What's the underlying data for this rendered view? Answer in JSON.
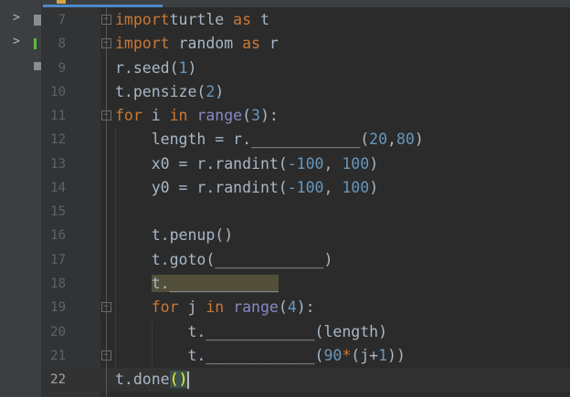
{
  "editor": {
    "current_line": 22,
    "lines": [
      {
        "n": "7",
        "tokens": [
          [
            "kw",
            "import"
          ],
          [
            "",
            "turtle"
          ],
          [
            "kw",
            " as"
          ],
          [
            "",
            " t"
          ]
        ]
      },
      {
        "n": "8",
        "tokens": [
          [
            "kw",
            "import"
          ],
          [
            "",
            " random"
          ],
          [
            "kw",
            " as"
          ],
          [
            "",
            " r"
          ]
        ]
      },
      {
        "n": "9",
        "tokens": [
          [
            "",
            "r.seed("
          ],
          [
            "num",
            "1"
          ],
          [
            "",
            ")"
          ]
        ]
      },
      {
        "n": "10",
        "tokens": [
          [
            "",
            "t.pensize("
          ],
          [
            "num",
            "2"
          ],
          [
            "",
            ")"
          ]
        ]
      },
      {
        "n": "11",
        "tokens": [
          [
            "kw",
            "for"
          ],
          [
            "",
            " i "
          ],
          [
            "kw",
            "in"
          ],
          [
            "",
            " "
          ],
          [
            "bi",
            "range"
          ],
          [
            "",
            "("
          ],
          [
            "num",
            "3"
          ],
          [
            "",
            "):"
          ]
        ]
      },
      {
        "n": "12",
        "tokens": [
          [
            "",
            "    length = r.____________("
          ],
          [
            "num",
            "20"
          ],
          [
            "",
            ","
          ],
          [
            "num",
            "80"
          ],
          [
            "",
            ")"
          ]
        ]
      },
      {
        "n": "13",
        "tokens": [
          [
            "",
            "    x0 = r.randint("
          ],
          [
            "num",
            "-100"
          ],
          [
            "",
            ", "
          ],
          [
            "num",
            "100"
          ],
          [
            "",
            ")"
          ]
        ]
      },
      {
        "n": "14",
        "tokens": [
          [
            "",
            "    y0 = r.randint("
          ],
          [
            "num",
            "-100"
          ],
          [
            "",
            ", "
          ],
          [
            "num",
            "100"
          ],
          [
            "",
            ")"
          ]
        ]
      },
      {
        "n": "15",
        "tokens": []
      },
      {
        "n": "16",
        "tokens": [
          [
            "",
            "    t.penup()"
          ]
        ]
      },
      {
        "n": "17",
        "tokens": [
          [
            "",
            "    t.goto(____________)"
          ]
        ]
      },
      {
        "n": "18",
        "tokens": [
          [
            "",
            "    "
          ],
          [
            "hl",
            "t.____________"
          ]
        ]
      },
      {
        "n": "19",
        "tokens": [
          [
            "",
            "    "
          ],
          [
            "kw",
            "for"
          ],
          [
            "",
            " j "
          ],
          [
            "kw",
            "in"
          ],
          [
            "",
            " "
          ],
          [
            "bi",
            "range"
          ],
          [
            "",
            "("
          ],
          [
            "num",
            "4"
          ],
          [
            "",
            "):"
          ]
        ]
      },
      {
        "n": "20",
        "tokens": [
          [
            "",
            "        t.____________(length)"
          ]
        ]
      },
      {
        "n": "21",
        "tokens": [
          [
            "",
            "        t.____________("
          ],
          [
            "num",
            "90"
          ],
          [
            "kw",
            "*"
          ],
          [
            "",
            "(j+"
          ],
          [
            "num",
            "1"
          ],
          [
            "",
            "))"
          ]
        ]
      },
      {
        "n": "22",
        "tokens": [
          [
            "",
            "t.done"
          ],
          [
            "br",
            "()"
          ],
          [
            "caret",
            ""
          ]
        ]
      }
    ]
  },
  "colors": {
    "keyword": "#cc7832",
    "number": "#6897bb",
    "builtin": "#8888c6",
    "text": "#a9b7c6",
    "background": "#2b2b2b"
  }
}
